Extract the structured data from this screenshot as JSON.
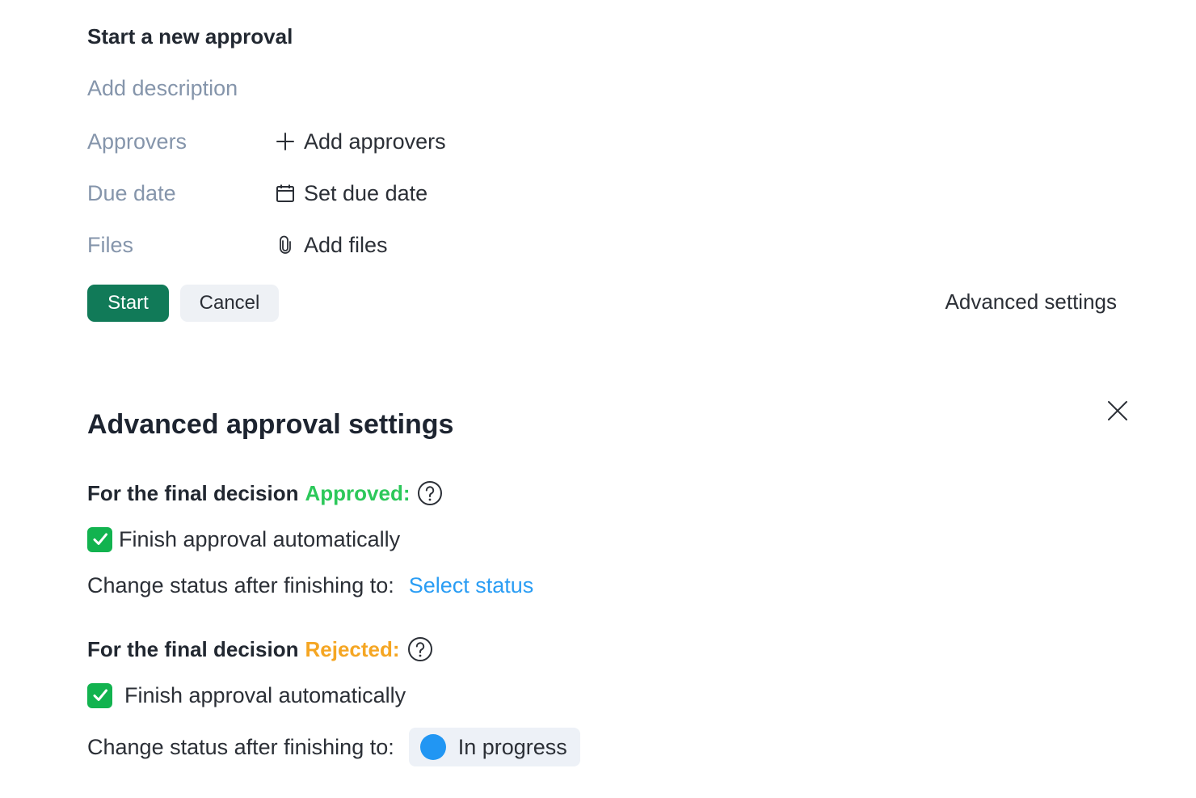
{
  "form": {
    "title": "Start a new approval",
    "description_placeholder": "Add description",
    "rows": {
      "approvers": {
        "label": "Approvers",
        "action": "Add approvers",
        "icon": "plus-icon"
      },
      "due_date": {
        "label": "Due date",
        "action": "Set due date",
        "icon": "calendar-icon"
      },
      "files": {
        "label": "Files",
        "action": "Add files",
        "icon": "paperclip-icon"
      }
    },
    "start_button": "Start",
    "cancel_button": "Cancel",
    "advanced_link": "Advanced settings"
  },
  "advanced": {
    "title": "Advanced approval settings",
    "close_icon": "close-icon",
    "approved": {
      "heading_prefix": "For the final decision",
      "keyword": "Approved:",
      "keyword_color": "#2cc85a",
      "help_icon": "question-circle-icon",
      "checkbox_label": "Finish approval automatically",
      "checked": true,
      "status_label": "Change status after finishing to:",
      "status_value": "Select status",
      "status_value_color": "#2a9df4"
    },
    "rejected": {
      "heading_prefix": "For the final decision",
      "keyword": "Rejected:",
      "keyword_color": "#f5a623",
      "help_icon": "question-circle-icon",
      "checkbox_label": "Finish approval automatically",
      "checked": true,
      "status_label": "Change status after finishing to:",
      "status_value": "In progress",
      "status_dot_color": "#2196f3"
    }
  },
  "colors": {
    "primary_button": "#117a58",
    "checkbox": "#12b34f",
    "muted_label": "#8595ab"
  }
}
